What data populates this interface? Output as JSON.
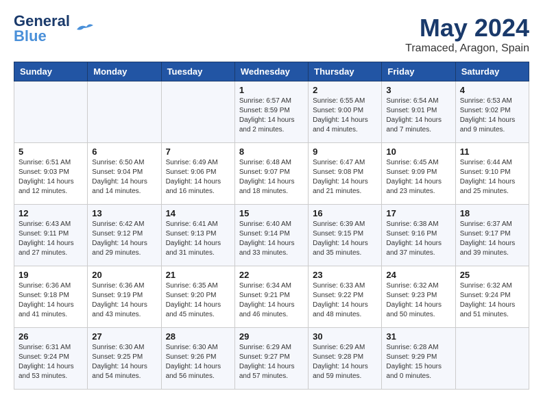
{
  "header": {
    "logo_line1": "General",
    "logo_line2": "Blue",
    "month": "May 2024",
    "location": "Tramaced, Aragon, Spain"
  },
  "days_of_week": [
    "Sunday",
    "Monday",
    "Tuesday",
    "Wednesday",
    "Thursday",
    "Friday",
    "Saturday"
  ],
  "weeks": [
    [
      {
        "day": "",
        "info": ""
      },
      {
        "day": "",
        "info": ""
      },
      {
        "day": "",
        "info": ""
      },
      {
        "day": "1",
        "info": "Sunrise: 6:57 AM\nSunset: 8:59 PM\nDaylight: 14 hours\nand 2 minutes."
      },
      {
        "day": "2",
        "info": "Sunrise: 6:55 AM\nSunset: 9:00 PM\nDaylight: 14 hours\nand 4 minutes."
      },
      {
        "day": "3",
        "info": "Sunrise: 6:54 AM\nSunset: 9:01 PM\nDaylight: 14 hours\nand 7 minutes."
      },
      {
        "day": "4",
        "info": "Sunrise: 6:53 AM\nSunset: 9:02 PM\nDaylight: 14 hours\nand 9 minutes."
      }
    ],
    [
      {
        "day": "5",
        "info": "Sunrise: 6:51 AM\nSunset: 9:03 PM\nDaylight: 14 hours\nand 12 minutes."
      },
      {
        "day": "6",
        "info": "Sunrise: 6:50 AM\nSunset: 9:04 PM\nDaylight: 14 hours\nand 14 minutes."
      },
      {
        "day": "7",
        "info": "Sunrise: 6:49 AM\nSunset: 9:06 PM\nDaylight: 14 hours\nand 16 minutes."
      },
      {
        "day": "8",
        "info": "Sunrise: 6:48 AM\nSunset: 9:07 PM\nDaylight: 14 hours\nand 18 minutes."
      },
      {
        "day": "9",
        "info": "Sunrise: 6:47 AM\nSunset: 9:08 PM\nDaylight: 14 hours\nand 21 minutes."
      },
      {
        "day": "10",
        "info": "Sunrise: 6:45 AM\nSunset: 9:09 PM\nDaylight: 14 hours\nand 23 minutes."
      },
      {
        "day": "11",
        "info": "Sunrise: 6:44 AM\nSunset: 9:10 PM\nDaylight: 14 hours\nand 25 minutes."
      }
    ],
    [
      {
        "day": "12",
        "info": "Sunrise: 6:43 AM\nSunset: 9:11 PM\nDaylight: 14 hours\nand 27 minutes."
      },
      {
        "day": "13",
        "info": "Sunrise: 6:42 AM\nSunset: 9:12 PM\nDaylight: 14 hours\nand 29 minutes."
      },
      {
        "day": "14",
        "info": "Sunrise: 6:41 AM\nSunset: 9:13 PM\nDaylight: 14 hours\nand 31 minutes."
      },
      {
        "day": "15",
        "info": "Sunrise: 6:40 AM\nSunset: 9:14 PM\nDaylight: 14 hours\nand 33 minutes."
      },
      {
        "day": "16",
        "info": "Sunrise: 6:39 AM\nSunset: 9:15 PM\nDaylight: 14 hours\nand 35 minutes."
      },
      {
        "day": "17",
        "info": "Sunrise: 6:38 AM\nSunset: 9:16 PM\nDaylight: 14 hours\nand 37 minutes."
      },
      {
        "day": "18",
        "info": "Sunrise: 6:37 AM\nSunset: 9:17 PM\nDaylight: 14 hours\nand 39 minutes."
      }
    ],
    [
      {
        "day": "19",
        "info": "Sunrise: 6:36 AM\nSunset: 9:18 PM\nDaylight: 14 hours\nand 41 minutes."
      },
      {
        "day": "20",
        "info": "Sunrise: 6:36 AM\nSunset: 9:19 PM\nDaylight: 14 hours\nand 43 minutes."
      },
      {
        "day": "21",
        "info": "Sunrise: 6:35 AM\nSunset: 9:20 PM\nDaylight: 14 hours\nand 45 minutes."
      },
      {
        "day": "22",
        "info": "Sunrise: 6:34 AM\nSunset: 9:21 PM\nDaylight: 14 hours\nand 46 minutes."
      },
      {
        "day": "23",
        "info": "Sunrise: 6:33 AM\nSunset: 9:22 PM\nDaylight: 14 hours\nand 48 minutes."
      },
      {
        "day": "24",
        "info": "Sunrise: 6:32 AM\nSunset: 9:23 PM\nDaylight: 14 hours\nand 50 minutes."
      },
      {
        "day": "25",
        "info": "Sunrise: 6:32 AM\nSunset: 9:24 PM\nDaylight: 14 hours\nand 51 minutes."
      }
    ],
    [
      {
        "day": "26",
        "info": "Sunrise: 6:31 AM\nSunset: 9:24 PM\nDaylight: 14 hours\nand 53 minutes."
      },
      {
        "day": "27",
        "info": "Sunrise: 6:30 AM\nSunset: 9:25 PM\nDaylight: 14 hours\nand 54 minutes."
      },
      {
        "day": "28",
        "info": "Sunrise: 6:30 AM\nSunset: 9:26 PM\nDaylight: 14 hours\nand 56 minutes."
      },
      {
        "day": "29",
        "info": "Sunrise: 6:29 AM\nSunset: 9:27 PM\nDaylight: 14 hours\nand 57 minutes."
      },
      {
        "day": "30",
        "info": "Sunrise: 6:29 AM\nSunset: 9:28 PM\nDaylight: 14 hours\nand 59 minutes."
      },
      {
        "day": "31",
        "info": "Sunrise: 6:28 AM\nSunset: 9:29 PM\nDaylight: 15 hours\nand 0 minutes."
      },
      {
        "day": "",
        "info": ""
      }
    ]
  ]
}
